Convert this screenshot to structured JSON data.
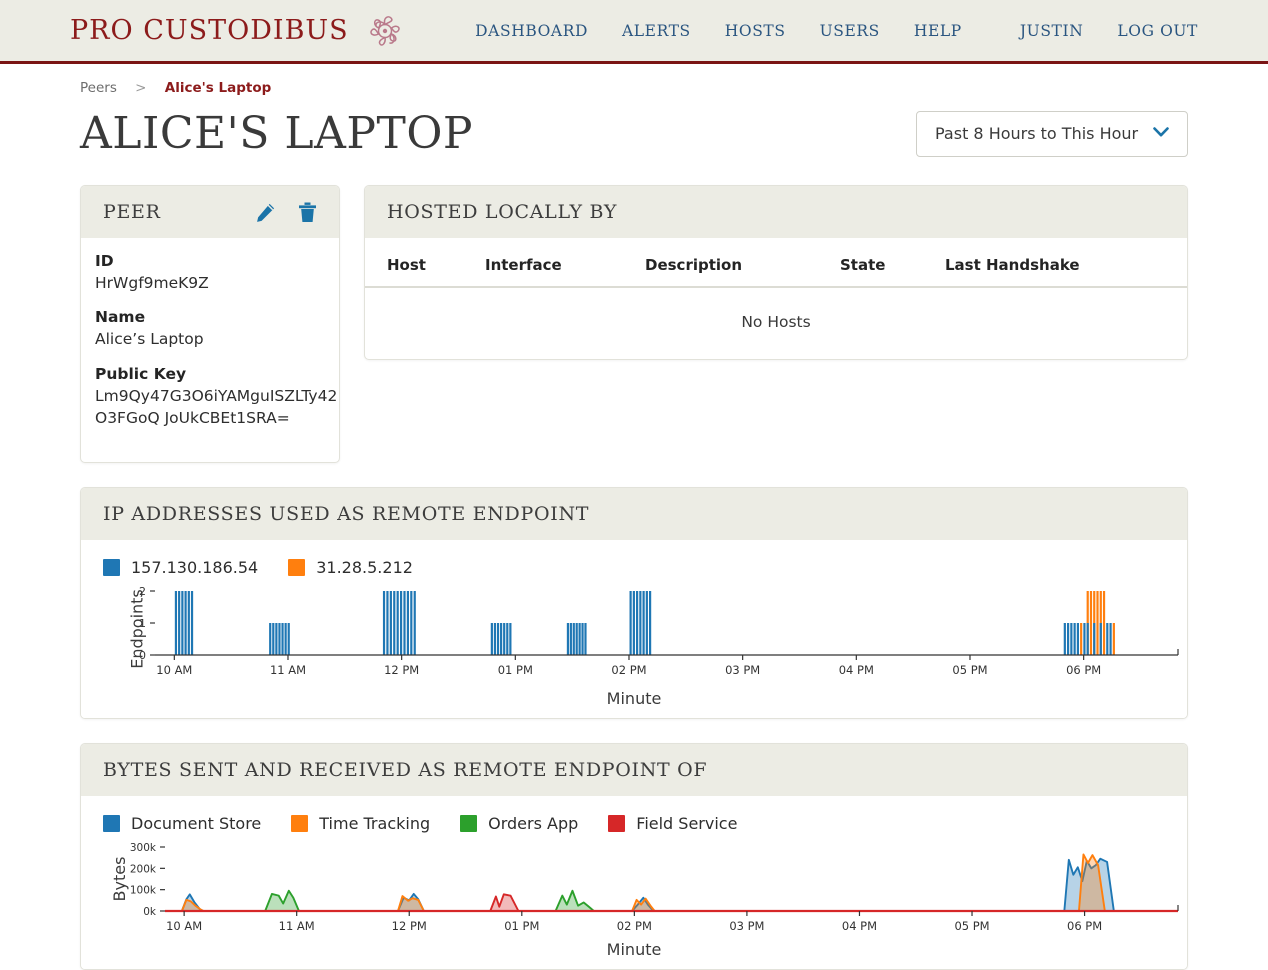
{
  "header": {
    "brand": "PRO CUSTODIBUS",
    "brand_mark_icon": "medusa-logo-icon",
    "accent_red": "#8c1b1b",
    "nav_link_color": "#2a5580",
    "nav": [
      {
        "label": "DASHBOARD",
        "name": "nav-dashboard"
      },
      {
        "label": "ALERTS",
        "name": "nav-alerts"
      },
      {
        "label": "HOSTS",
        "name": "nav-hosts"
      },
      {
        "label": "USERS",
        "name": "nav-users"
      },
      {
        "label": "HELP",
        "name": "nav-help"
      },
      {
        "label": "JUSTIN",
        "name": "nav-account"
      },
      {
        "label": "LOG OUT",
        "name": "nav-logout"
      }
    ]
  },
  "breadcrumb": {
    "parent": "Peers",
    "separator": ">",
    "current": "Alice's Laptop"
  },
  "page": {
    "title": "ALICE'S LAPTOP"
  },
  "range_select": {
    "value": "Past 8 Hours to This Hour",
    "chevron_icon": "chevron-down-icon"
  },
  "peer_card": {
    "heading": "PEER",
    "edit_icon": "pencil-icon",
    "delete_icon": "trash-icon",
    "fields": [
      {
        "label": "ID",
        "value": "HrWgf9meK9Z"
      },
      {
        "label": "Name",
        "value": "Alice’s Laptop"
      },
      {
        "label": "Public Key",
        "value": "Lm9Qy47G3O6iYAMguISZLTy42O3FGoQ JoUkCBEt1SRA="
      }
    ]
  },
  "hosts_card": {
    "heading": "HOSTED LOCALLY BY",
    "columns": [
      "Host",
      "Interface",
      "Description",
      "State",
      "Last Handshake"
    ],
    "empty_message": "No Hosts"
  },
  "endpoints_panel": {
    "heading": "IP ADDRESSES USED AS REMOTE ENDPOINT"
  },
  "bytes_panel": {
    "heading": "BYTES SENT AND RECEIVED AS REMOTE ENDPOINT OF"
  },
  "chart_data": [
    {
      "name": "ip-addresses-used-as-remote-endpoint",
      "type": "bar",
      "title": "IP ADDRESSES USED AS REMOTE ENDPOINT",
      "xlabel": "Minute",
      "ylabel": "Endpoints",
      "ylim": [
        0,
        2
      ],
      "yticks": [
        0,
        1,
        2
      ],
      "xticks": [
        "10 AM",
        "11 AM",
        "12 PM",
        "01 PM",
        "02 PM",
        "03 PM",
        "04 PM",
        "05 PM",
        "06 PM"
      ],
      "xlim_hours": [
        9.83,
        18.83
      ],
      "grid": false,
      "legend_position": "above-left",
      "stacked": true,
      "series": [
        {
          "name": "157.130.186.54",
          "color": "#1f77b4"
        },
        {
          "name": "31.28.5.212",
          "color": "#ff7f0e"
        }
      ],
      "clusters": [
        {
          "start_hour": 10.0,
          "end_hour": 10.17,
          "bars": 6,
          "blue": 2,
          "orange": 0
        },
        {
          "start_hour": 10.83,
          "end_hour": 11.02,
          "bars": 7,
          "blue": 1,
          "orange": 0
        },
        {
          "start_hour": 11.83,
          "end_hour": 12.13,
          "bars": 10,
          "blue": 2,
          "orange": 0
        },
        {
          "start_hour": 12.78,
          "end_hour": 12.97,
          "bars": 7,
          "blue": 1,
          "orange": 0
        },
        {
          "start_hour": 13.45,
          "end_hour": 13.63,
          "bars": 7,
          "blue": 1,
          "orange": 0
        },
        {
          "start_hour": 14.0,
          "end_hour": 14.2,
          "bars": 7,
          "blue": 2,
          "orange": 0
        },
        {
          "start_hour": 17.82,
          "end_hour": 18.28,
          "bars": 16,
          "blue": 1,
          "orange": 1,
          "mixed": true
        }
      ]
    },
    {
      "name": "bytes-sent-and-received-as-remote-endpoint-of",
      "type": "area",
      "title": "BYTES SENT AND RECEIVED AS REMOTE ENDPOINT OF",
      "xlabel": "Minute",
      "ylabel": "Bytes",
      "ylim": [
        0,
        300000
      ],
      "yticks": [
        0,
        100000,
        200000,
        300000
      ],
      "ytick_labels": [
        "0k",
        "100k",
        "200k",
        "300k"
      ],
      "xticks": [
        "10 AM",
        "11 AM",
        "12 PM",
        "01 PM",
        "02 PM",
        "03 PM",
        "04 PM",
        "05 PM",
        "06 PM"
      ],
      "xlim_hours": [
        9.83,
        18.83
      ],
      "grid": false,
      "legend_position": "above-left",
      "series": [
        {
          "name": "Document Store",
          "color": "#1f77b4",
          "points": [
            [
              9.98,
              0
            ],
            [
              10.02,
              55000
            ],
            [
              10.05,
              78000
            ],
            [
              10.09,
              42000
            ],
            [
              10.14,
              8000
            ],
            [
              10.17,
              0
            ],
            [
              11.9,
              0
            ],
            [
              11.95,
              62000
            ],
            [
              12.0,
              50000
            ],
            [
              12.04,
              80000
            ],
            [
              12.08,
              55000
            ],
            [
              12.13,
              0
            ],
            [
              13.98,
              0
            ],
            [
              14.03,
              30000
            ],
            [
              14.08,
              62000
            ],
            [
              14.12,
              30000
            ],
            [
              14.17,
              0
            ],
            [
              17.82,
              0
            ],
            [
              17.86,
              240000
            ],
            [
              17.9,
              170000
            ],
            [
              17.94,
              205000
            ],
            [
              17.98,
              140000
            ],
            [
              18.02,
              235000
            ],
            [
              18.06,
              200000
            ],
            [
              18.1,
              215000
            ],
            [
              18.14,
              245000
            ],
            [
              18.2,
              230000
            ],
            [
              18.26,
              0
            ]
          ]
        },
        {
          "name": "Time Tracking",
          "color": "#ff7f0e",
          "points": [
            [
              9.98,
              0
            ],
            [
              10.02,
              52000
            ],
            [
              10.06,
              45000
            ],
            [
              10.1,
              25000
            ],
            [
              10.15,
              6000
            ],
            [
              10.17,
              0
            ],
            [
              11.9,
              0
            ],
            [
              11.94,
              70000
            ],
            [
              11.99,
              48000
            ],
            [
              12.03,
              60000
            ],
            [
              12.08,
              52000
            ],
            [
              12.13,
              0
            ],
            [
              13.98,
              0
            ],
            [
              14.02,
              52000
            ],
            [
              14.06,
              30000
            ],
            [
              14.1,
              58000
            ],
            [
              14.15,
              20000
            ],
            [
              14.18,
              0
            ],
            [
              17.95,
              0
            ],
            [
              17.99,
              265000
            ],
            [
              18.03,
              225000
            ],
            [
              18.07,
              262000
            ],
            [
              18.12,
              215000
            ],
            [
              18.18,
              0
            ]
          ]
        },
        {
          "name": "Orders App",
          "color": "#2ca02c",
          "points": [
            [
              10.72,
              0
            ],
            [
              10.78,
              80000
            ],
            [
              10.84,
              72000
            ],
            [
              10.88,
              35000
            ],
            [
              10.93,
              95000
            ],
            [
              10.97,
              62000
            ],
            [
              11.02,
              0
            ],
            [
              13.3,
              0
            ],
            [
              13.36,
              72000
            ],
            [
              13.4,
              30000
            ],
            [
              13.45,
              95000
            ],
            [
              13.5,
              25000
            ],
            [
              13.55,
              40000
            ],
            [
              13.6,
              18000
            ],
            [
              13.64,
              0
            ]
          ]
        },
        {
          "name": "Field Service",
          "color": "#d62728",
          "points": [
            [
              12.72,
              0
            ],
            [
              12.77,
              68000
            ],
            [
              12.8,
              20000
            ],
            [
              12.84,
              78000
            ],
            [
              12.9,
              72000
            ],
            [
              12.97,
              0
            ]
          ]
        }
      ]
    }
  ]
}
